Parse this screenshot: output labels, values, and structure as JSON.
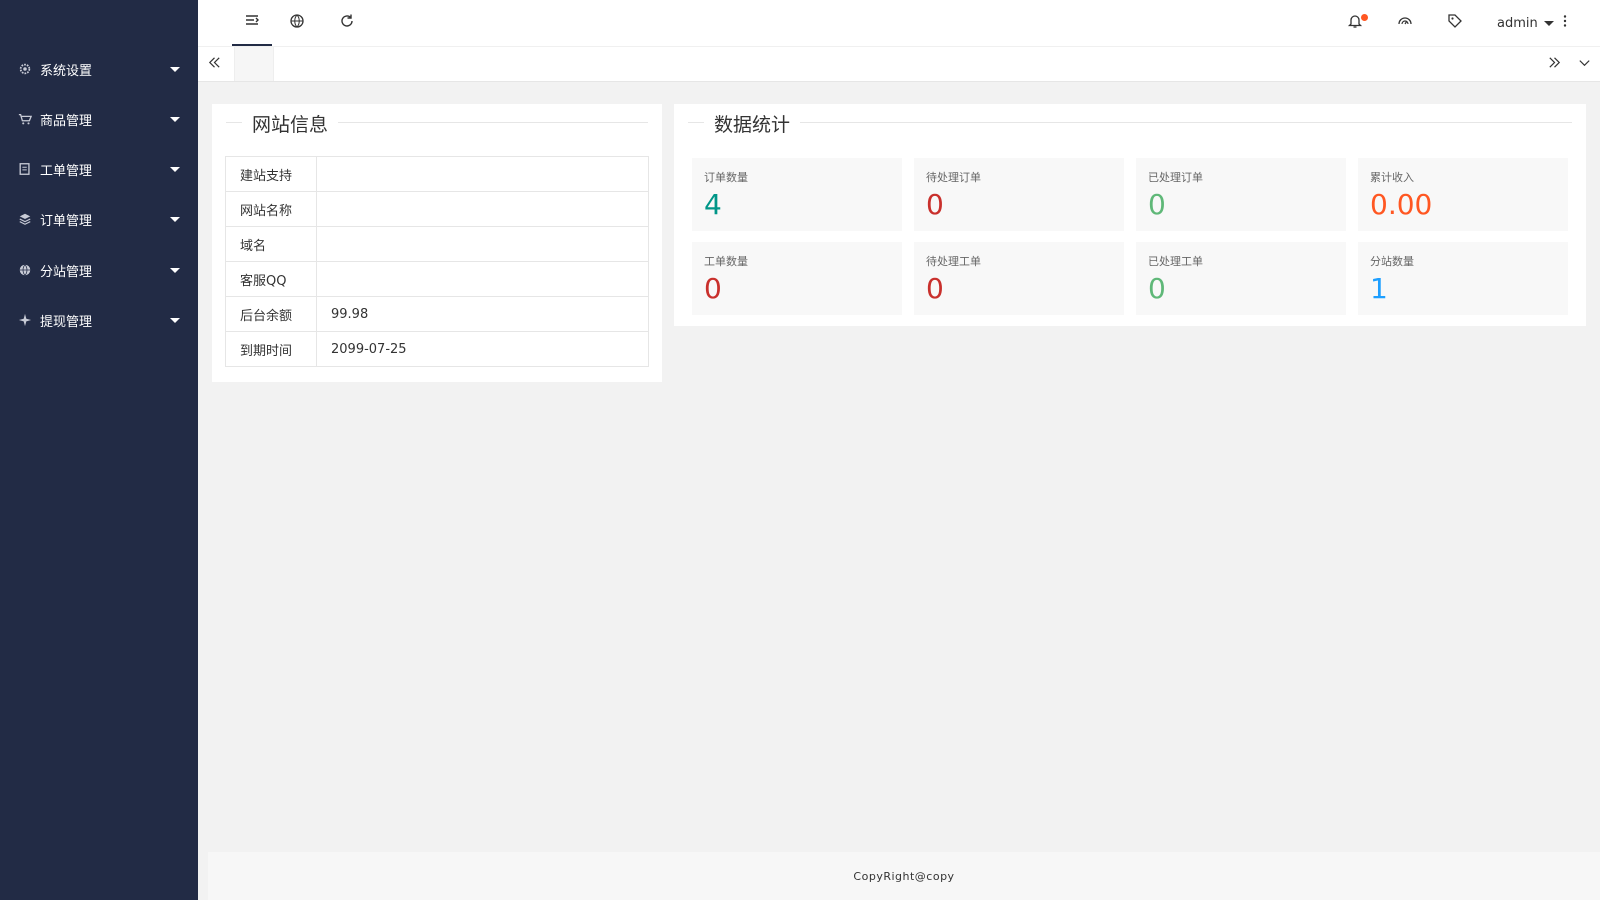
{
  "sidebar": {
    "items": [
      {
        "label": "系统设置",
        "icon": "gear-icon"
      },
      {
        "label": "商品管理",
        "icon": "cart-icon"
      },
      {
        "label": "工单管理",
        "icon": "ticket-icon"
      },
      {
        "label": "订单管理",
        "icon": "layers-icon"
      },
      {
        "label": "分站管理",
        "icon": "globe-icon"
      },
      {
        "label": "提现管理",
        "icon": "star-icon"
      }
    ]
  },
  "header": {
    "user_name": "admin",
    "icons": [
      "menu-toggle-icon",
      "globe-icon",
      "refresh-icon",
      "bell-icon",
      "theme-icon",
      "tag-icon",
      "more-vertical-icon"
    ]
  },
  "tabs": {
    "home_icon": "home-icon"
  },
  "site_info": {
    "title": "网站信息",
    "rows": [
      {
        "key": "建站支持",
        "value": ""
      },
      {
        "key": "网站名称",
        "value": ""
      },
      {
        "key": "域名",
        "value": ""
      },
      {
        "key": "客服QQ",
        "value": ""
      },
      {
        "key": "后台余额",
        "value": "99.98"
      },
      {
        "key": "到期时间",
        "value": "2099-07-25"
      }
    ]
  },
  "stats": {
    "title": "数据统计",
    "cards": [
      {
        "label": "订单数量",
        "value": "4",
        "color": "#009688"
      },
      {
        "label": "待处理订单",
        "value": "0",
        "color": "#c9302c"
      },
      {
        "label": "已处理订单",
        "value": "0",
        "color": "#5fb878"
      },
      {
        "label": "累计收入",
        "value": "0.00",
        "color": "#ff5722"
      },
      {
        "label": "工单数量",
        "value": "0",
        "color": "#c9302c"
      },
      {
        "label": "待处理工单",
        "value": "0",
        "color": "#c9302c"
      },
      {
        "label": "已处理工单",
        "value": "0",
        "color": "#5fb878"
      },
      {
        "label": "分站数量",
        "value": "1",
        "color": "#1e9fff"
      }
    ]
  },
  "footer": {
    "text": "CopyRight@copy"
  }
}
